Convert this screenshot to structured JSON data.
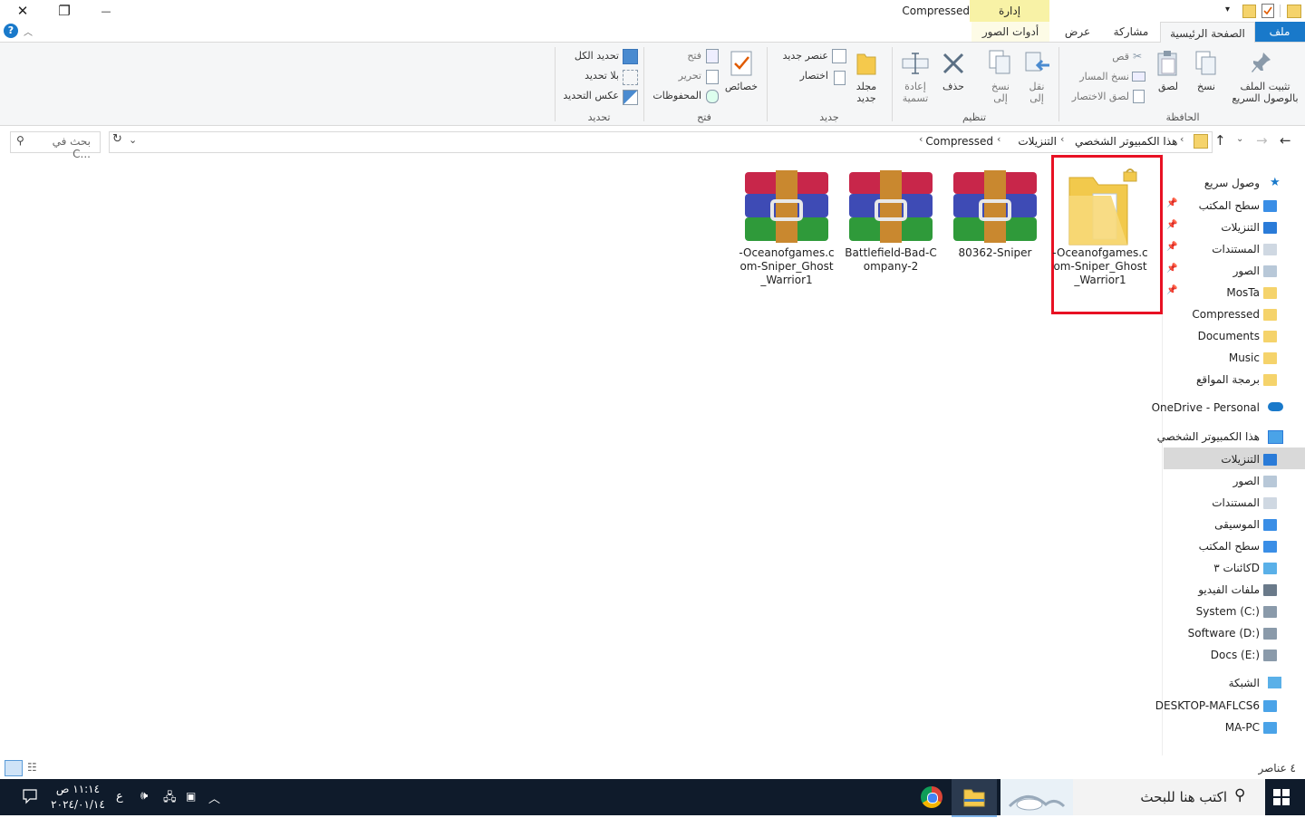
{
  "window": {
    "title": "Compressed",
    "contextual_tab_group": "إدارة",
    "close_glyph": "✕",
    "maximize_glyph": "❐",
    "minimize_glyph": "—"
  },
  "tabs": {
    "file": "ملف",
    "home": "الصفحة الرئيسية",
    "share": "مشاركة",
    "view": "عرض",
    "picture_tools": "أدوات الصور"
  },
  "ribbon": {
    "clipboard": {
      "title": "الحافظة",
      "pin": "تثبيت الملف بالوصول السريع",
      "copy": "نسخ",
      "paste": "لصق",
      "cut": "قص",
      "copy_path": "نسخ المسار",
      "paste_shortcut": "لصق الاختصار"
    },
    "organize": {
      "title": "تنظيم",
      "move_to": "نقل إلى",
      "copy_to": "نسخ إلى",
      "delete": "حذف",
      "rename": "إعادة تسمية"
    },
    "new": {
      "title": "جديد",
      "new_folder": "مجلد جديد",
      "new_item": "عنصر جديد",
      "easy_access": "اختصار"
    },
    "open": {
      "title": "فتح",
      "properties": "خصائص",
      "open": "فتح",
      "edit": "تحرير",
      "history": "المحفوظات"
    },
    "select": {
      "title": "تحديد",
      "select_all": "تحديد الكل",
      "select_none": "بلا تحديد",
      "invert": "عكس التحديد"
    }
  },
  "address": {
    "crumbs": [
      "هذا الكمبيوتر الشخصي",
      "التنزيلات",
      "Compressed"
    ],
    "search_placeholder": "بحث في C..."
  },
  "nav": {
    "quick_access": "وصول سريع",
    "quick_items": [
      "سطح المكتب",
      "التنزيلات",
      "المستندات",
      "الصور",
      "MosTa",
      "Compressed",
      "Documents",
      "Music",
      "برمجة المواقع"
    ],
    "onedrive": "OneDrive - Personal",
    "this_pc": "هذا الكمبيوتر الشخصي",
    "pc_items": [
      "التنزيلات",
      "الصور",
      "المستندات",
      "الموسيقى",
      "سطح المكتب",
      "كائنات ٣D",
      "ملفات الفيديو",
      "System (C:)",
      "Software (D:)",
      "Docs (E:)"
    ],
    "network": "الشبكة",
    "network_items": [
      "DESKTOP-MAFLCS6",
      "MA-PC"
    ]
  },
  "files": [
    {
      "name": "-Oceanofgames.com-Sniper_Ghost_Warrior1",
      "type": "folder",
      "selected": true
    },
    {
      "name": "80362-Sniper",
      "type": "rar"
    },
    {
      "name": "Battlefield-Bad-Company-2",
      "type": "rar"
    },
    {
      "name": "-Oceanofgames.com-Sniper_Ghost_Warrior1",
      "type": "rar"
    }
  ],
  "status": {
    "item_count": "٤ عناصر"
  },
  "taskbar": {
    "search_placeholder": "اكتب هنا للبحث",
    "time": "١١:١٤ ص",
    "date": "٢٠٢٤/٠١/١٤",
    "lang": "ع"
  },
  "colors": {
    "accent": "#1979ca",
    "highlight": "#e81123",
    "taskbar": "#0f1b2b",
    "manage_tab": "#f8f2a6"
  }
}
